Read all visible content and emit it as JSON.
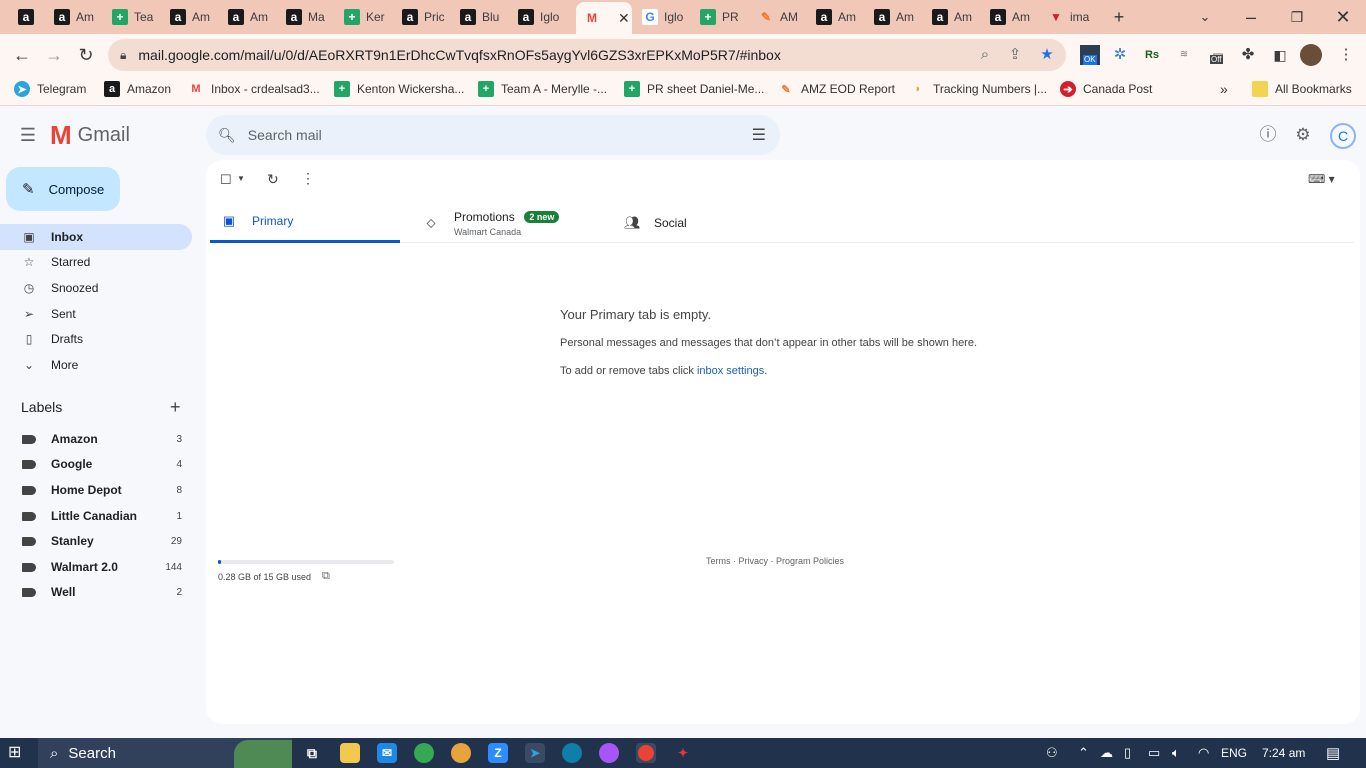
{
  "browser": {
    "tabs": [
      {
        "favicon": "amazon",
        "title": ""
      },
      {
        "favicon": "amazon",
        "title": "Am"
      },
      {
        "favicon": "sheets",
        "title": "Tea"
      },
      {
        "favicon": "amazon",
        "title": "Am"
      },
      {
        "favicon": "amazon",
        "title": "Am"
      },
      {
        "favicon": "amazon",
        "title": "Ma"
      },
      {
        "favicon": "sheets",
        "title": "Ker"
      },
      {
        "favicon": "amazon-smile",
        "title": "Pric"
      },
      {
        "favicon": "amazon-smile",
        "title": "Blu"
      },
      {
        "favicon": "amazon-smile",
        "title": "Iglo"
      },
      {
        "favicon": "gmail",
        "title": ""
      },
      {
        "favicon": "google",
        "title": "Iglo"
      },
      {
        "favicon": "sheets",
        "title": "PR"
      },
      {
        "favicon": "pen",
        "title": "AM"
      },
      {
        "favicon": "amazon",
        "title": "Am"
      },
      {
        "favicon": "amazon",
        "title": "Am"
      },
      {
        "favicon": "amazon",
        "title": "Am"
      },
      {
        "favicon": "amazon",
        "title": "Am"
      },
      {
        "favicon": "red-triangle",
        "title": "ima"
      }
    ],
    "url": "mail.google.com/mail/u/0/d/AEoRXRT9n1ErDhcCwTvqfsxRnOFs5aygYvl6GZS3xrEPKxMoP5R7/#inbox",
    "bookmarks": [
      {
        "icon": "telegram",
        "label": "Telegram"
      },
      {
        "icon": "amazon",
        "label": "Amazon"
      },
      {
        "icon": "gmail",
        "label": "Inbox - crdealsad3..."
      },
      {
        "icon": "sheets",
        "label": "Kenton Wickersha..."
      },
      {
        "icon": "sheets",
        "label": "Team A - Merylle -..."
      },
      {
        "icon": "sheets",
        "label": "PR sheet Daniel-Me..."
      },
      {
        "icon": "pen",
        "label": "AMZ EOD Report"
      },
      {
        "icon": "taco",
        "label": "Tracking Numbers |..."
      },
      {
        "icon": "canada-post",
        "label": "Canada Post"
      }
    ],
    "all_bookmarks": "All Bookmarks",
    "extension_badges": {
      "ok": "OK",
      "off": "Off"
    }
  },
  "gmail": {
    "logo_text": "Gmail",
    "search_placeholder": "Search mail",
    "account_initial": "C",
    "compose": "Compose",
    "nav": [
      {
        "icon": "inbox-icon",
        "label": "Inbox",
        "active": true
      },
      {
        "icon": "star-icon",
        "label": "Starred"
      },
      {
        "icon": "clock-icon",
        "label": "Snoozed"
      },
      {
        "icon": "send-icon",
        "label": "Sent"
      },
      {
        "icon": "draft-icon",
        "label": "Drafts"
      },
      {
        "icon": "chevron-down-icon",
        "label": "More"
      }
    ],
    "labels_title": "Labels",
    "labels": [
      {
        "name": "Amazon",
        "count": "3"
      },
      {
        "name": "Google",
        "count": "4"
      },
      {
        "name": "Home Depot",
        "count": "8"
      },
      {
        "name": "Little Canadian",
        "count": "1"
      },
      {
        "name": "Stanley",
        "count": "29"
      },
      {
        "name": "Walmart 2.0",
        "count": "144"
      },
      {
        "name": "Well",
        "count": "2"
      }
    ],
    "tabs": {
      "primary": "Primary",
      "promotions": "Promotions",
      "promotions_badge": "2 new",
      "promotions_sub": "Walmart Canada",
      "social": "Social"
    },
    "empty": {
      "title": "Your Primary tab is empty.",
      "description": "Personal messages and messages that don’t appear in other tabs will be shown here.",
      "settings_prefix": "To add or remove tabs click ",
      "settings_link": "inbox settings",
      "settings_suffix": "."
    },
    "storage": {
      "text": "0.28 GB of 15 GB used",
      "fraction": 0.019
    },
    "footer": "Terms · Privacy · Program Policies"
  },
  "taskbar": {
    "search": "Search",
    "language": "ENG",
    "time": "7:24 am"
  },
  "colors": {
    "accent": "#0b57d0",
    "compose_bg": "#c2e7ff",
    "active_nav_bg": "#d3e3fd",
    "badge_green": "#188038",
    "tabstrip_bg": "#f1c7b7"
  }
}
